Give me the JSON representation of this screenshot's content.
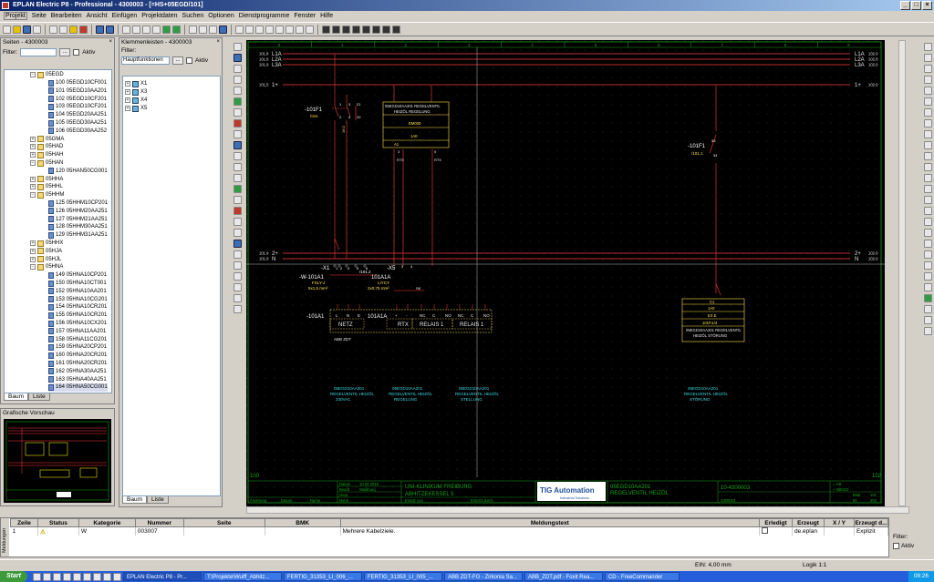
{
  "window": {
    "title": "EPLAN Electric P8 - Professional - 4300003 - [=HS+05EGD/101]",
    "btn_min": "_",
    "btn_max": "□",
    "btn_close": "×",
    "panel_close": "×"
  },
  "menu": [
    "Projekt",
    "Seite",
    "Bearbeiten",
    "Ansicht",
    "Einfügen",
    "Projektdaten",
    "Suchen",
    "Optionen",
    "Dienstprogramme",
    "Fenster",
    "Hilfe"
  ],
  "pages_panel": {
    "title": "Seiten - 4300003",
    "filter_label": "Filter:",
    "filter_button": "...",
    "active_label": "Aktiv",
    "tab_tree": "Baum",
    "tab_list": "Liste",
    "items": [
      {
        "label": "05EGD",
        "type": "folder",
        "depth": 0,
        "expanded": true
      },
      {
        "label": "100 05EGD10CF001",
        "type": "page",
        "depth": 1
      },
      {
        "label": "101 05EGD10AA201",
        "type": "page",
        "depth": 1
      },
      {
        "label": "102 05EGD10CF201",
        "type": "page",
        "depth": 1
      },
      {
        "label": "103 05EGD10CF201",
        "type": "page",
        "depth": 1
      },
      {
        "label": "104 05EGD20AA251",
        "type": "page",
        "depth": 1
      },
      {
        "label": "105 05EGD30AA251",
        "type": "page",
        "depth": 1
      },
      {
        "label": "106 05EGD30AA252",
        "type": "page",
        "depth": 1
      },
      {
        "label": "05GMA",
        "type": "folder",
        "depth": 0
      },
      {
        "label": "05HAD",
        "type": "folder",
        "depth": 0
      },
      {
        "label": "05HAH",
        "type": "folder",
        "depth": 0
      },
      {
        "label": "05HAN",
        "type": "folder",
        "depth": 0,
        "expanded": true
      },
      {
        "label": "120 05HAN50CG001",
        "type": "page",
        "depth": 1
      },
      {
        "label": "05HHA",
        "type": "folder",
        "depth": 0
      },
      {
        "label": "05HHL",
        "type": "folder",
        "depth": 0
      },
      {
        "label": "05HHM",
        "type": "folder",
        "depth": 0,
        "expanded": true
      },
      {
        "label": "125 05HHM10CP201",
        "type": "page",
        "depth": 1
      },
      {
        "label": "126 05HHM20AA251",
        "type": "page",
        "depth": 1
      },
      {
        "label": "127 05HHM21AA251",
        "type": "page",
        "depth": 1
      },
      {
        "label": "128 05HHM30AA251",
        "type": "page",
        "depth": 1
      },
      {
        "label": "129 05HHM31AA251",
        "type": "page",
        "depth": 1
      },
      {
        "label": "05HHX",
        "type": "folder",
        "depth": 0
      },
      {
        "label": "05HJA",
        "type": "folder",
        "depth": 0
      },
      {
        "label": "05HJL",
        "type": "folder",
        "depth": 0
      },
      {
        "label": "05HNA",
        "type": "folder",
        "depth": 0,
        "expanded": true
      },
      {
        "label": "149 05HNA10CP201",
        "type": "page",
        "depth": 1
      },
      {
        "label": "150 05HNA10CT001",
        "type": "page",
        "depth": 1
      },
      {
        "label": "152 05HNA10AA201",
        "type": "page",
        "depth": 1
      },
      {
        "label": "153 05HNA10CG201",
        "type": "page",
        "depth": 1
      },
      {
        "label": "154 05HNA10CR201",
        "type": "page",
        "depth": 1
      },
      {
        "label": "155 05HNA10CR201",
        "type": "page",
        "depth": 1
      },
      {
        "label": "156 05HNA10CX201",
        "type": "page",
        "depth": 1
      },
      {
        "label": "157 05HNA11AA201",
        "type": "page",
        "depth": 1
      },
      {
        "label": "158 05HNA11CG201",
        "type": "page",
        "depth": 1
      },
      {
        "label": "159 05HNA20CP201",
        "type": "page",
        "depth": 1
      },
      {
        "label": "160 05HNA20CR201",
        "type": "page",
        "depth": 1
      },
      {
        "label": "161 05HNA20CR201",
        "type": "page",
        "depth": 1
      },
      {
        "label": "162 05HNA30AA251",
        "type": "page",
        "depth": 1
      },
      {
        "label": "163 05HNA40AA251",
        "type": "page",
        "depth": 1
      },
      {
        "label": "164 05HNA50CG001",
        "type": "page",
        "depth": 1,
        "selected": true
      }
    ]
  },
  "terminal_panel": {
    "title": "Klemmenleisten - 4300003",
    "filter_label": "Filter:",
    "filter_value": "Hauptfunktionen",
    "filter_button": "...",
    "active_label": "Aktiv",
    "tab_tree": "Baum",
    "tab_list": "Liste",
    "items": [
      "X1",
      "X3",
      "X4",
      "X5"
    ]
  },
  "preview_panel": {
    "title": "Grafische Vorschau"
  },
  "schematic": {
    "col_numbers": [
      "0",
      "1",
      "2",
      "3",
      "4",
      "5",
      "6",
      "7",
      "8",
      "9"
    ],
    "rails": [
      {
        "ref": "101.8",
        "name": "L1A",
        "right_name": "L1A",
        "right_ref": "102.0",
        "color": "#ff3b3b"
      },
      {
        "ref": "101.9",
        "name": "L2A",
        "right_name": "L2A",
        "right_ref": "102.0",
        "color": "#ff3b3b"
      },
      {
        "ref": "101.9",
        "name": "L3A",
        "right_name": "L3A",
        "right_ref": "102.0",
        "color": "#ff3b3b"
      },
      {
        "ref": "101.5",
        "name": "1+",
        "right_name": "1+",
        "right_ref": "102.0",
        "color": "#ff3b3b"
      },
      {
        "ref": "101.9",
        "name": "2+",
        "right_name": "2+",
        "right_ref": "102.0",
        "color": "#ff3b3b"
      },
      {
        "ref": "101.9",
        "name": "N",
        "right_name": "N",
        "right_ref": "102.0",
        "color": "#ff3b3b"
      }
    ],
    "breaker": {
      "tag": "-101F1",
      "rating": "C6A",
      "contact_nums": [
        "1",
        "3",
        "2",
        "4",
        "21",
        "22"
      ]
    },
    "breaker_vert_label": "16.0",
    "relay_box": {
      "line1": "05EGD10AA201 REGELVENTIL",
      "line2": "HEIZÖL REGELUNG",
      "code": "EM000",
      "value": "1A0",
      "left_pin": "A1",
      "pins": [
        "3",
        "5"
      ],
      "bottom": [
        "RTX",
        "RTX"
      ]
    },
    "contact2": {
      "tag": "-101F1",
      "ref": "/101.1",
      "num1": "33",
      "num2": "34"
    },
    "terminal_x1": {
      "tag": "-X1",
      "pins": [
        "1",
        "2",
        "4",
        "5",
        "6"
      ]
    },
    "cable": {
      "tag": "-W-101A1",
      "type": "FSLY-J",
      "size": "5x1,5 mm²"
    },
    "cable2": {
      "tag": "101A1A",
      "type": "LIYCY",
      "size": "2x0,75 mm²",
      "ref": "/101.2",
      "x5": "-X5",
      "pins": [
        "3",
        "4"
      ]
    },
    "device_row": {
      "tag": "-101A1",
      "left_label": "101A1A",
      "cells": [
        "L",
        "N",
        "E",
        "+",
        "-",
        "NC",
        "C",
        "NO",
        "NC",
        "C",
        "NO"
      ],
      "groups": [
        "NETZ",
        "RTX",
        "RELAIS 1",
        "RELAIS 1"
      ],
      "footer": "ABB ZDT"
    },
    "sk_label": "SK",
    "right_box": {
      "line1": "C1",
      "line2": "1A0",
      "line3": "EX.E",
      "line4": "101P.1/4",
      "line5": "05EGD10AA201 REGELVENTIL",
      "line6": "HEIZÖL STÖRUNG"
    },
    "notes": [
      {
        "l1": "05EGD10AA201",
        "l2": "REGELVENTIL HEIZÖL",
        "l3": "230VAC"
      },
      {
        "l1": "05EGD10AA201",
        "l2": "REGELVENTIL HEIZÖL",
        "l3": "REGELUNG"
      },
      {
        "l1": "05EGD10AA201",
        "l2": "REGELVENTIL HEIZÖL",
        "l3": "STELLUNG"
      },
      {
        "l1": "05EGD10AA201",
        "l2": "REGELVENTIL HEIZÖL",
        "l3": "STÖRUNG"
      }
    ],
    "page_left": "100",
    "page_right": "102",
    "titleblock": {
      "datum_label": "Datum",
      "datum": "10.02.2016",
      "bearb_label": "Bearb.",
      "bearb": "Waldburg",
      "gepr_label": "Gepr.",
      "norm_label": "Norm",
      "aenderung": "Änderung",
      "datum2": "Datum",
      "name": "Name",
      "project1": "UNI-KLINIKUM FREIBURG",
      "project2": "ABHITZEKESSEL 5",
      "ersatz_fuer": "Ersatz von",
      "ersetzt_durch": "Ersetzt durch",
      "logo": "TIG Automation",
      "logo_sub": "Industrial Solutions",
      "desc1": "05EGD10AA201",
      "desc2": "REGELVENTIL HEIZÖL",
      "drawing": "10-4300003",
      "drawing2": "4300003",
      "eq": "= HS",
      "loc": "+ 05EGD",
      "blatt_label": "Blatt",
      "blatt": "101",
      "bl_label": "Bl.",
      "bl": "203"
    }
  },
  "messages": {
    "side_label": "Meldungen",
    "columns": [
      "Zeile",
      "Status",
      "Kategorie",
      "Nummer",
      "Seite",
      "BMK",
      "Meldungstext",
      "Erledigt",
      "Erzeugt",
      "X / Y",
      "Erzeugt d..."
    ],
    "rows": [
      {
        "zeile": "1",
        "status": "⚠",
        "kategorie": "W",
        "nummer": "003007",
        "seite": "",
        "bmk": "",
        "text": "Mehrere Kabelziele.",
        "erledigt": "",
        "erzeugt": "de.eplan",
        "xy": "",
        "erzeugt_d": "Explizit"
      }
    ],
    "filter_label": "Filter:",
    "active_label": "Aktiv"
  },
  "statusbar": {
    "ein": "EIN: 4,00 mm",
    "logic": "Logik 1:1"
  },
  "taskbar": {
    "start": "Start",
    "tasks": [
      "EPLAN Electric P8 - Pr...",
      "T:\\Projekte\\Wulff_Abhitz...",
      "FERTIG_31353_LI_006_...",
      "FERTIG_31353_LI_005_...",
      "ABB ZDT-FG - Zirkonia Sa...",
      "ABB_ZDT.pdf - Foxit Rea...",
      "CD - FreeCommander"
    ],
    "clock": "08:26"
  }
}
